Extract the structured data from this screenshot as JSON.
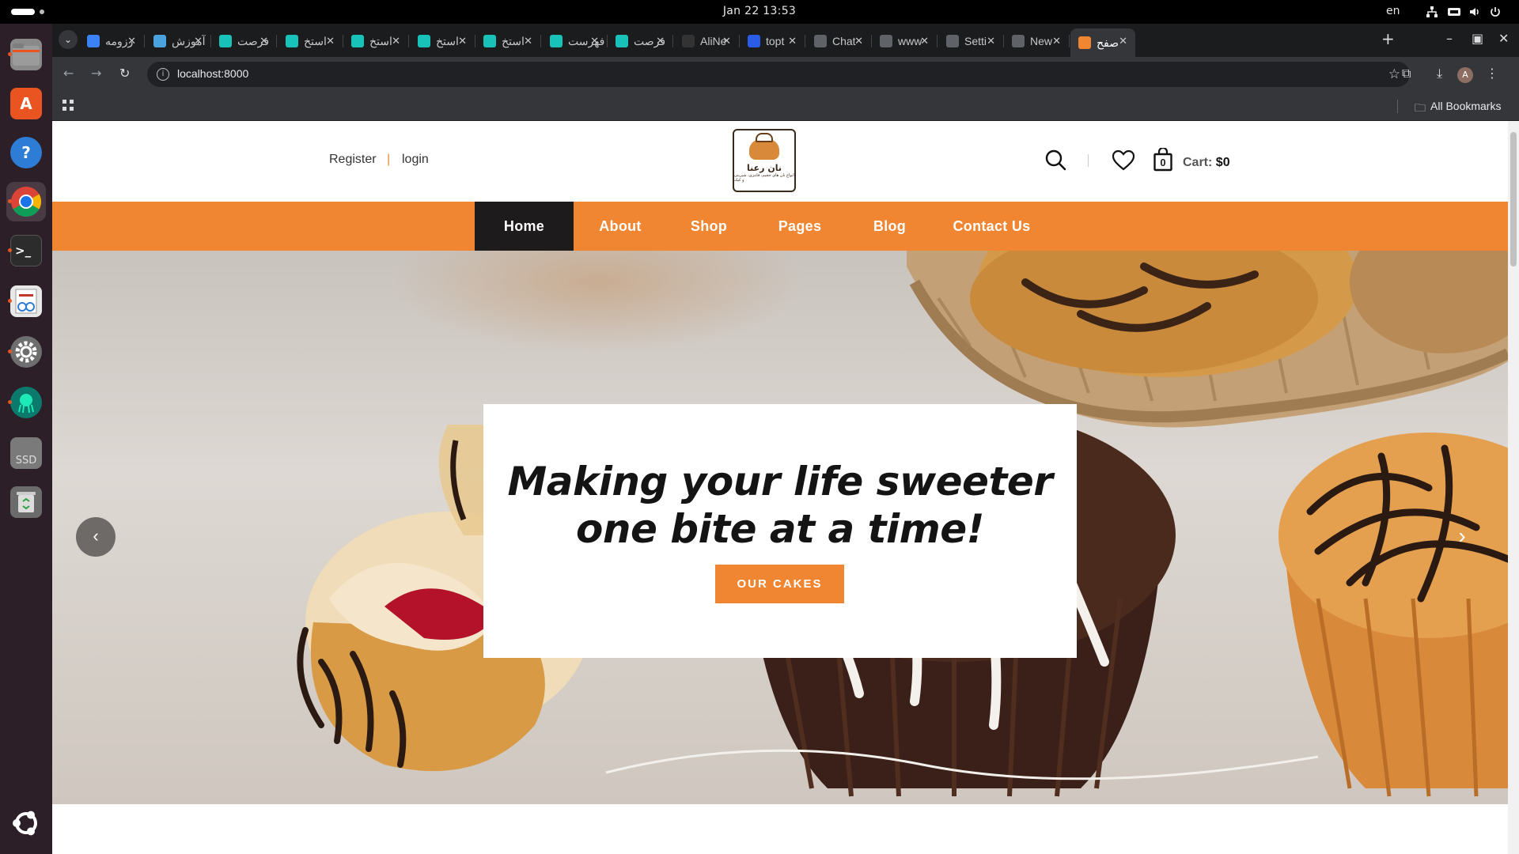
{
  "os": {
    "clock": "Jan 22  13:53",
    "lang": "en"
  },
  "dock": {
    "items": [
      {
        "name": "files-icon",
        "color": "#8a8a8a"
      },
      {
        "name": "app-center-icon",
        "color": "#e95420"
      },
      {
        "name": "help-icon",
        "color": "#2d7cd6"
      },
      {
        "name": "chrome-icon",
        "color": "#1a73e8"
      },
      {
        "name": "terminal-icon",
        "color": "#2c2c2c"
      },
      {
        "name": "document-viewer-icon",
        "color": "#e8e8e8"
      },
      {
        "name": "settings-icon",
        "color": "#6e6e6e"
      },
      {
        "name": "gitkraken-icon",
        "color": "#0b7a6c"
      },
      {
        "name": "ssd-drive-icon",
        "color": "#7a7a7a"
      },
      {
        "name": "trash-icon",
        "color": "#6b6b6b"
      }
    ],
    "ssd_label": "SSD"
  },
  "browser": {
    "tabs": [
      {
        "title": "رزومه",
        "fav_color": "#3b82f6",
        "icon": "tab-favicon-icon"
      },
      {
        "title": "آموزش",
        "fav_color": "#4aa3df",
        "icon": "tab-favicon-icon"
      },
      {
        "title": "فرصت",
        "fav_color": "#19c2b8",
        "icon": "tab-favicon-icon"
      },
      {
        "title": "استخ",
        "fav_color": "#19c2b8",
        "icon": "tab-favicon-icon"
      },
      {
        "title": "استخ",
        "fav_color": "#19c2b8",
        "icon": "tab-favicon-icon"
      },
      {
        "title": "استخ",
        "fav_color": "#19c2b8",
        "icon": "tab-favicon-icon"
      },
      {
        "title": "استخ",
        "fav_color": "#19c2b8",
        "icon": "tab-favicon-icon"
      },
      {
        "title": "فهرست",
        "fav_color": "#19c2b8",
        "icon": "tab-favicon-icon"
      },
      {
        "title": "فرصت",
        "fav_color": "#19c2b8",
        "icon": "tab-favicon-icon"
      },
      {
        "title": "AliNe",
        "fav_color": "#333333",
        "icon": "tab-favicon-icon"
      },
      {
        "title": "topt",
        "fav_color": "#2b5ce6",
        "icon": "tab-favicon-icon"
      },
      {
        "title": "Chat",
        "fav_color": "#5f6368",
        "icon": "tab-favicon-icon"
      },
      {
        "title": "www",
        "fav_color": "#5f6368",
        "icon": "tab-favicon-icon"
      },
      {
        "title": "Setti",
        "fav_color": "#5f6368",
        "icon": "tab-favicon-icon"
      },
      {
        "title": "New",
        "fav_color": "#5f6368",
        "icon": "tab-favicon-icon"
      },
      {
        "title": "صفح",
        "fav_color": "#f08632",
        "icon": "tab-favicon-icon"
      }
    ],
    "url": "localhost:8000",
    "profile_initial": "A",
    "bookmarks_label": "All Bookmarks"
  },
  "site": {
    "auth": {
      "register": "Register",
      "separator": "|",
      "login": "login"
    },
    "logo": {
      "title": "نان رعنا",
      "subtitle": "انواع نان های حجیم، فانتزی، شیرینی و کیک"
    },
    "cart": {
      "count": "0",
      "label": "Cart:",
      "amount": "$0"
    },
    "nav": [
      {
        "label": "Home",
        "active": true
      },
      {
        "label": "About",
        "active": false
      },
      {
        "label": "Shop",
        "active": false
      },
      {
        "label": "Pages",
        "active": false
      },
      {
        "label": "Blog",
        "active": false
      },
      {
        "label": "Contact Us",
        "active": false
      }
    ],
    "hero": {
      "title_line1": "Making your life sweeter",
      "title_line2": "one bite at a time!",
      "button": "OUR CAKES"
    },
    "colors": {
      "accent": "#f08632",
      "nav_active": "#1d1b1b"
    }
  }
}
